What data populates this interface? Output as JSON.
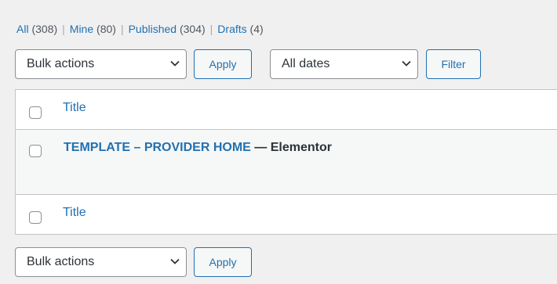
{
  "views": [
    {
      "label": "All",
      "count": "(308)",
      "current": false
    },
    {
      "label": "Mine",
      "count": "(80)",
      "current": false
    },
    {
      "label": "Published",
      "count": "(304)",
      "current": false
    },
    {
      "label": "Drafts",
      "count": "(4)",
      "current": false
    }
  ],
  "separator": "|",
  "top_nav": {
    "bulk_actions": "Bulk actions",
    "apply": "Apply",
    "dates": "All dates",
    "filter": "Filter"
  },
  "table": {
    "column_title": "Title",
    "rows": [
      {
        "title": "TEMPLATE – PROVIDER HOME",
        "state": " — Elementor"
      }
    ],
    "footer_title": "Title"
  },
  "bottom_nav": {
    "bulk_actions": "Bulk actions",
    "apply": "Apply"
  },
  "colors": {
    "link": "#2271b1",
    "background": "#f0f0f1",
    "border": "#c3c4c7"
  }
}
